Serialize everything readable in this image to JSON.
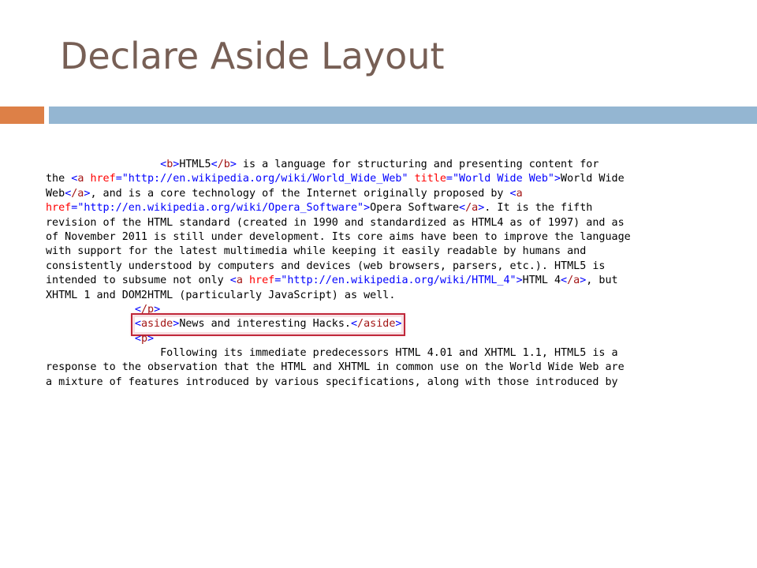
{
  "slide": {
    "title": "Declare Aside Layout"
  },
  "code": {
    "l1_pre": "                  ",
    "l1_tag1": "b",
    "l1_text1": "HTML5",
    "l1_tag2": "/b",
    "l1_text2": " is a language for structuring and presenting content for",
    "l2_text1": "the ",
    "l2_tag": "a",
    "l2_attr1": "href",
    "l2_val1": "\"http://en.wikipedia.org/wiki/World_Wide_Web\"",
    "l2_attr2": "title",
    "l2_val2": "\"World Wide Web\"",
    "l2_text2": "World Wide",
    "l3_text1": "Web",
    "l3_tag1": "/a",
    "l3_text2": ", and is a core technology of the Internet originally proposed by ",
    "l3_tag2": "a",
    "l4_attr": "href",
    "l4_val": "\"http://en.wikipedia.org/wiki/Opera_Software\"",
    "l4_text1": "Opera Software",
    "l4_tag": "/a",
    "l4_text2": ". It is the fifth",
    "l5": "revision of the HTML standard (created in 1990 and standardized as HTML4 as of 1997) and as",
    "l6": "of November 2011 is still under development. Its core aims have been to improve the language",
    "l7": "with support for the latest multimedia while keeping it easily readable by humans and",
    "l8": "consistently understood by computers and devices (web browsers, parsers, etc.). HTML5 is",
    "l9_text1": "intended to subsume not only ",
    "l9_tag": "a",
    "l9_attr": "href",
    "l9_val": "\"http://en.wikipedia.org/wiki/HTML_4\"",
    "l9_text2": "HTML 4",
    "l9_tag2": "/a",
    "l9_text3": ", but",
    "l10": "XHTML 1 and DOM2HTML (particularly JavaScript) as well.",
    "l11_pre": "              ",
    "l11_tag": "/p",
    "l12_pre": "              ",
    "l12_tag1": "aside",
    "l12_text": "News and interesting Hacks.",
    "l12_tag2": "/aside",
    "l13_pre": "              ",
    "l13_tag": "p",
    "l14": "                  Following its immediate predecessors HTML 4.01 and XHTML 1.1, HTML5 is a",
    "l15": "response to the observation that the HTML and XHTML in common use on the World Wide Web are",
    "l16": "a mixture of features introduced by various specifications, along with those introduced by"
  },
  "colors": {
    "title": "#775f55",
    "accent_orange": "#dd8047",
    "accent_blue": "#94b6d2",
    "tag": "#a31515",
    "attribute": "#ff0000",
    "value": "#0000ff",
    "highlight_box": "#c0283a"
  }
}
